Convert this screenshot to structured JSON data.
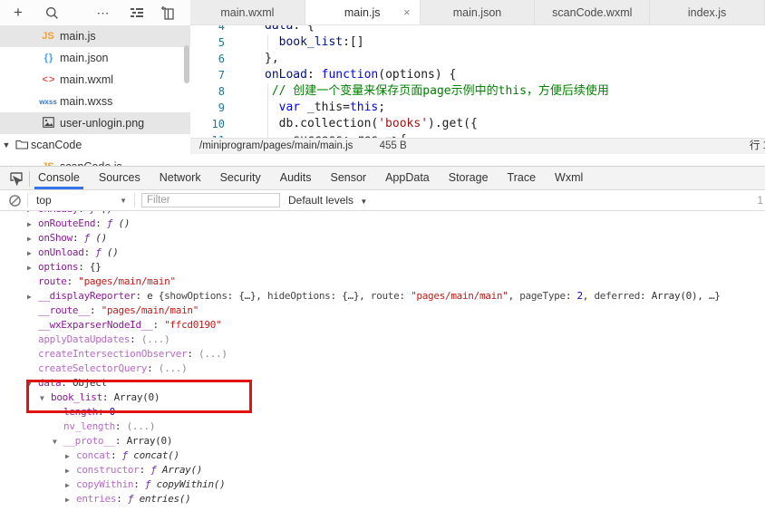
{
  "colors": {
    "accent_blue": "#3672e9",
    "annotation_red": "#e01212",
    "js_icon_orange": "#f0a030",
    "json_icon_blue": "#4a9ff5",
    "wxml_icon_red": "#e2574c",
    "wxss_icon_blue": "#3b78c3"
  },
  "top": {
    "toolbar_icons": [
      "add-icon",
      "search-icon",
      "more-icon",
      "file-list-icon",
      "collapse-sidebar-icon"
    ],
    "tabs": [
      {
        "label": "main.wxml",
        "active": false
      },
      {
        "label": "main.js",
        "active": true,
        "close": "×"
      },
      {
        "label": "main.json",
        "active": false
      },
      {
        "label": "scanCode.wxml",
        "active": false
      },
      {
        "label": "index.js",
        "active": false
      }
    ]
  },
  "sidebar": {
    "files": [
      {
        "label": "main.js",
        "icon": "js",
        "icon_text": "JS",
        "selected": true,
        "kind": "file"
      },
      {
        "label": "main.json",
        "icon": "json",
        "icon_text": "{ }",
        "selected": false,
        "kind": "file"
      },
      {
        "label": "main.wxml",
        "icon": "wxml",
        "icon_text": "< >",
        "selected": false,
        "kind": "file"
      },
      {
        "label": "main.wxss",
        "icon": "wxss",
        "icon_text": "wxss",
        "selected": false,
        "kind": "file"
      },
      {
        "label": "user-unlogin.png",
        "icon": "image",
        "icon_text": "",
        "selected": true,
        "kind": "file"
      },
      {
        "label": "scanCode",
        "icon": "folder",
        "icon_text": "",
        "selected": false,
        "kind": "folder",
        "expander": "▼"
      },
      {
        "label": "scanCode.js",
        "icon": "js",
        "icon_text": "JS",
        "selected": false,
        "kind": "file"
      }
    ]
  },
  "editor": {
    "lines": [
      {
        "num": "4",
        "tokens": [
          [
            "data",
            "key"
          ],
          [
            ": {",
            "pln"
          ]
        ]
      },
      {
        "num": "5",
        "tokens": [
          [
            "  ",
            "pln"
          ],
          [
            "book_list",
            "key"
          ],
          [
            ":[]",
            "pln"
          ]
        ]
      },
      {
        "num": "6",
        "tokens": [
          [
            "},",
            "pln"
          ]
        ]
      },
      {
        "num": "7",
        "tokens": [
          [
            "onLoad",
            "key"
          ],
          [
            ": ",
            "pln"
          ],
          [
            "function",
            "kw"
          ],
          [
            "(options) {",
            "pln"
          ]
        ]
      },
      {
        "num": "8",
        "tokens": [
          [
            " ",
            "pln"
          ],
          [
            "// 创建一个变量来保存页面page示例中的this，方便后续使用",
            "com"
          ]
        ]
      },
      {
        "num": "9",
        "tokens": [
          [
            "  ",
            "pln"
          ],
          [
            "var",
            "kw"
          ],
          [
            " _this=",
            "pln"
          ],
          [
            "this",
            "kw"
          ],
          [
            ";",
            "pln"
          ]
        ]
      },
      {
        "num": "10",
        "tokens": [
          [
            "  db.collection(",
            "pln"
          ],
          [
            "'books'",
            "str"
          ],
          [
            ").get({",
            "pln"
          ]
        ]
      },
      {
        "num": "11",
        "tokens": [
          [
            "    success: res =>{",
            "pln"
          ]
        ]
      }
    ],
    "status": {
      "path": "/miniprogram/pages/main/main.js",
      "size": "455 B",
      "line_col": "行 1"
    }
  },
  "devtools": {
    "tabs": [
      {
        "label": "Console",
        "active": true
      },
      {
        "label": "Sources",
        "active": false
      },
      {
        "label": "Network",
        "active": false
      },
      {
        "label": "Security",
        "active": false
      },
      {
        "label": "Audits",
        "active": false
      },
      {
        "label": "Sensor",
        "active": false
      },
      {
        "label": "AppData",
        "active": false
      },
      {
        "label": "Storage",
        "active": false
      },
      {
        "label": "Trace",
        "active": false
      },
      {
        "label": "Wxml",
        "active": false
      }
    ],
    "filter": {
      "context": "top",
      "placeholder": "Filter",
      "levels_label": "Default levels",
      "hidden_count": "1"
    },
    "console": {
      "lines": [
        {
          "indent": 1,
          "arrow": "r",
          "parts": [
            [
              "onReady",
              "prop"
            ],
            [
              ": ",
              "pln"
            ],
            [
              "ƒ",
              "fn"
            ],
            [
              " ()",
              "fnp"
            ]
          ]
        },
        {
          "indent": 1,
          "arrow": "r",
          "parts": [
            [
              "onRouteEnd",
              "prop"
            ],
            [
              ": ",
              "pln"
            ],
            [
              "ƒ",
              "fn"
            ],
            [
              " ()",
              "fnp"
            ]
          ]
        },
        {
          "indent": 1,
          "arrow": "r",
          "parts": [
            [
              "onShow",
              "prop"
            ],
            [
              ": ",
              "pln"
            ],
            [
              "ƒ",
              "fn"
            ],
            [
              " ()",
              "fnp"
            ]
          ]
        },
        {
          "indent": 1,
          "arrow": "r",
          "parts": [
            [
              "onUnload",
              "prop"
            ],
            [
              ": ",
              "pln"
            ],
            [
              "ƒ",
              "fn"
            ],
            [
              " ()",
              "fnp"
            ]
          ]
        },
        {
          "indent": 1,
          "arrow": "r",
          "parts": [
            [
              "options",
              "prop"
            ],
            [
              ": ",
              "pln"
            ],
            [
              "{}",
              "pln"
            ]
          ]
        },
        {
          "indent": 1,
          "arrow": "",
          "parts": [
            [
              "route",
              "prop"
            ],
            [
              ": ",
              "pln"
            ],
            [
              "\"pages/main/main\"",
              "str"
            ]
          ]
        },
        {
          "indent": 1,
          "arrow": "r",
          "parts": [
            [
              "__displayReporter",
              "prop"
            ],
            [
              ": ",
              "pln"
            ],
            [
              "e {",
              "pln"
            ],
            [
              "showOptions",
              "prev"
            ],
            [
              ": ",
              "pln"
            ],
            [
              "{…}",
              "pln"
            ],
            [
              ", ",
              "pln"
            ],
            [
              "hideOptions",
              "prev"
            ],
            [
              ": ",
              "pln"
            ],
            [
              "{…}",
              "pln"
            ],
            [
              ", ",
              "pln"
            ],
            [
              "route",
              "prev"
            ],
            [
              ": ",
              "pln"
            ],
            [
              "\"pages/main/main\"",
              "str"
            ],
            [
              ", ",
              "pln"
            ],
            [
              "pageType",
              "prev"
            ],
            [
              ": ",
              "pln"
            ],
            [
              "2",
              "num"
            ],
            [
              ", ",
              "pln"
            ],
            [
              "deferred",
              "prev"
            ],
            [
              ": ",
              "pln"
            ],
            [
              "Array(0)",
              "pln"
            ],
            [
              ", …}",
              "pln"
            ]
          ]
        },
        {
          "indent": 1,
          "arrow": "",
          "parts": [
            [
              "__route__",
              "prop"
            ],
            [
              ": ",
              "pln"
            ],
            [
              "\"pages/main/main\"",
              "str"
            ]
          ]
        },
        {
          "indent": 1,
          "arrow": "",
          "parts": [
            [
              "__wxExparserNodeId__",
              "prop"
            ],
            [
              ": ",
              "pln"
            ],
            [
              "\"ffcd0190\"",
              "str"
            ]
          ]
        },
        {
          "indent": 1,
          "arrow": "",
          "parts": [
            [
              "applyDataUpdates",
              "dprop"
            ],
            [
              ": ",
              "pln"
            ],
            [
              "(...)",
              "dim"
            ]
          ]
        },
        {
          "indent": 1,
          "arrow": "",
          "parts": [
            [
              "createIntersectionObserver",
              "dprop"
            ],
            [
              ": ",
              "pln"
            ],
            [
              "(...)",
              "dim"
            ]
          ]
        },
        {
          "indent": 1,
          "arrow": "",
          "parts": [
            [
              "createSelectorQuery",
              "dprop"
            ],
            [
              ": ",
              "pln"
            ],
            [
              "(...)",
              "dim"
            ]
          ]
        },
        {
          "indent": 1,
          "arrow": "d",
          "parts": [
            [
              "data",
              "prop"
            ],
            [
              ": ",
              "pln"
            ],
            [
              "Object",
              "pln"
            ]
          ]
        },
        {
          "indent": 2,
          "arrow": "d",
          "parts": [
            [
              "book_list",
              "prop"
            ],
            [
              ": ",
              "pln"
            ],
            [
              "Array(0)",
              "pln"
            ]
          ]
        },
        {
          "indent": 3,
          "arrow": "",
          "parts": [
            [
              "length",
              "prop"
            ],
            [
              ": ",
              "pln"
            ],
            [
              "0",
              "num"
            ]
          ]
        },
        {
          "indent": 3,
          "arrow": "",
          "parts": [
            [
              "nv_length",
              "dprop"
            ],
            [
              ": ",
              "pln"
            ],
            [
              "(...)",
              "dim"
            ]
          ]
        },
        {
          "indent": 3,
          "arrow": "d",
          "parts": [
            [
              "__proto__",
              "dprop"
            ],
            [
              ": ",
              "pln"
            ],
            [
              "Array(0)",
              "pln"
            ]
          ]
        },
        {
          "indent": 4,
          "arrow": "r",
          "parts": [
            [
              "concat",
              "dprop"
            ],
            [
              ": ",
              "pln"
            ],
            [
              "ƒ ",
              "fn"
            ],
            [
              "concat()",
              "fnp"
            ]
          ]
        },
        {
          "indent": 4,
          "arrow": "r",
          "parts": [
            [
              "constructor",
              "dprop"
            ],
            [
              ": ",
              "pln"
            ],
            [
              "ƒ ",
              "fn"
            ],
            [
              "Array()",
              "fnp"
            ]
          ]
        },
        {
          "indent": 4,
          "arrow": "r",
          "parts": [
            [
              "copyWithin",
              "dprop"
            ],
            [
              ": ",
              "pln"
            ],
            [
              "ƒ ",
              "fn"
            ],
            [
              "copyWithin()",
              "fnp"
            ]
          ]
        },
        {
          "indent": 4,
          "arrow": "r",
          "parts": [
            [
              "entries",
              "dprop"
            ],
            [
              ": ",
              "pln"
            ],
            [
              "ƒ ",
              "fn"
            ],
            [
              "entries()",
              "fnp"
            ]
          ]
        }
      ]
    }
  }
}
